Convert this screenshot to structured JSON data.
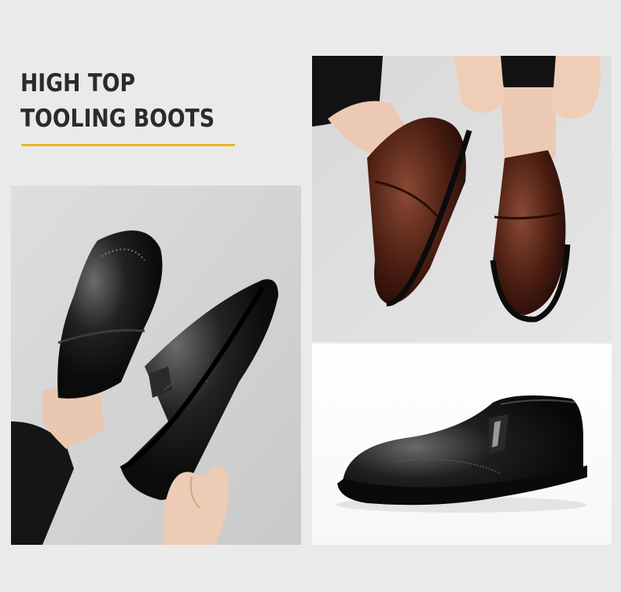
{
  "heading": {
    "line1": "HIGH TOP",
    "line2": "TOOLING BOOTS"
  },
  "colors": {
    "accent": "#e8b824",
    "title": "#2b2b2b",
    "background": "#eaeaea",
    "leather_black": "#151515",
    "leather_brown": "#5a2418"
  },
  "images": {
    "left": "black-slip-on-shoes-held-in-hand",
    "top_right": "brown-slip-on-shoes-worn",
    "bottom_right": "black-slip-on-shoe-side-view"
  }
}
